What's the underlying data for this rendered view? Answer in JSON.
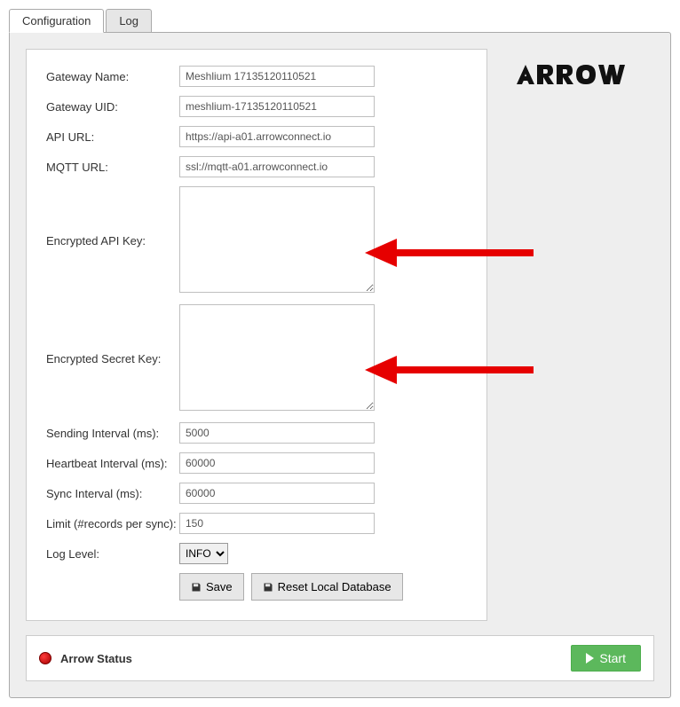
{
  "tabs": {
    "configuration": "Configuration",
    "log": "Log"
  },
  "logo_text": "ARROW",
  "form": {
    "gateway_name": {
      "label": "Gateway Name:",
      "value": "Meshlium 17135120110521"
    },
    "gateway_uid": {
      "label": "Gateway UID:",
      "value": "meshlium-17135120110521"
    },
    "api_url": {
      "label": "API URL:",
      "value": "https://api-a01.arrowconnect.io"
    },
    "mqtt_url": {
      "label": "MQTT URL:",
      "value": "ssl://mqtt-a01.arrowconnect.io"
    },
    "encrypted_api_key": {
      "label": "Encrypted API Key:",
      "value": ""
    },
    "encrypted_secret_key": {
      "label": "Encrypted Secret Key:",
      "value": ""
    },
    "sending_interval": {
      "label": "Sending Interval (ms):",
      "value": "5000"
    },
    "heartbeat_interval": {
      "label": "Heartbeat Interval (ms):",
      "value": "60000"
    },
    "sync_interval": {
      "label": "Sync Interval (ms):",
      "value": "60000"
    },
    "limit": {
      "label": "Limit (#records per sync):",
      "value": "150"
    },
    "log_level": {
      "label": "Log Level:",
      "value": "INFO"
    }
  },
  "buttons": {
    "save": "Save",
    "reset_db": "Reset Local Database",
    "start": "Start"
  },
  "status": {
    "label": "Arrow Status"
  }
}
